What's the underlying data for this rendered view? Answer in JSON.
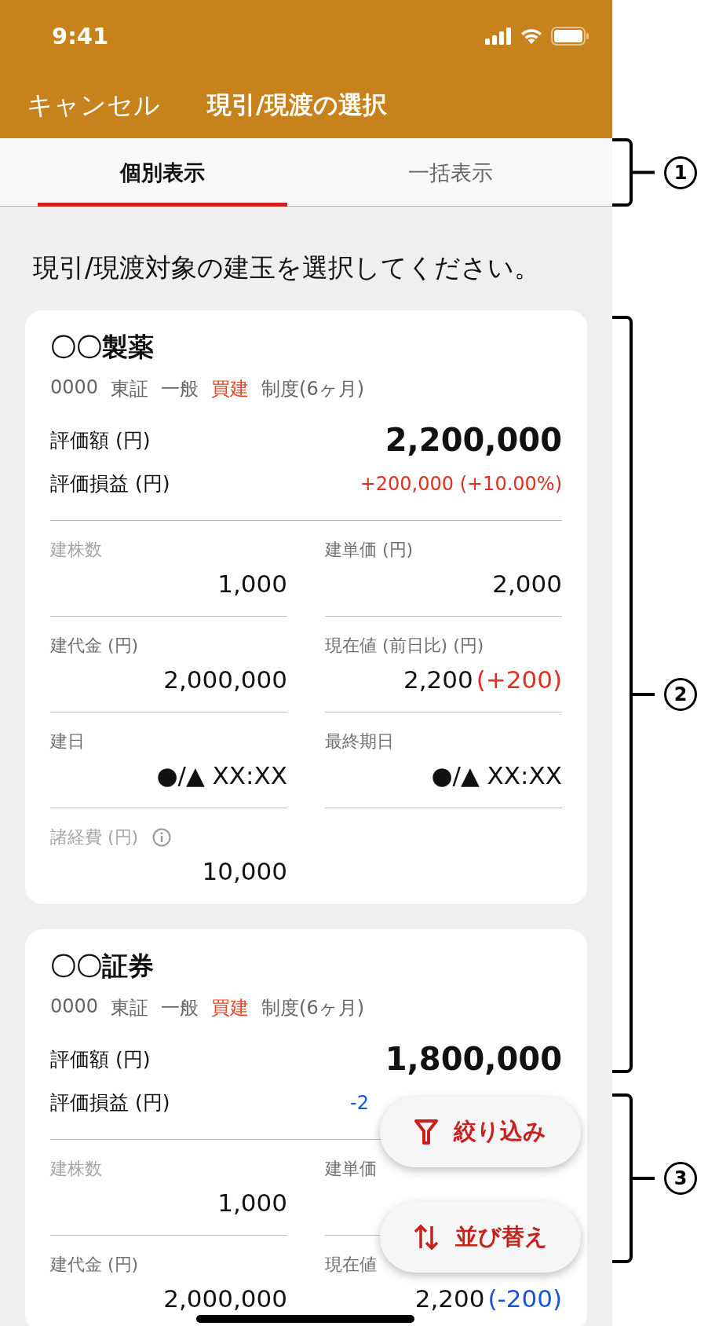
{
  "status_bar": {
    "time": "9:41"
  },
  "nav": {
    "cancel": "キャンセル",
    "title": "現引/現渡の選択"
  },
  "tabs": [
    {
      "label": "個別表示",
      "selected": true
    },
    {
      "label": "一括表示",
      "selected": false
    }
  ],
  "instruction": "現引/現渡対象の建玉を選択してください。",
  "cards": [
    {
      "name": "〇〇製薬",
      "meta": [
        {
          "text": "0000",
          "kind": "plain"
        },
        {
          "text": "東証",
          "kind": "plain"
        },
        {
          "text": "一般",
          "kind": "plain"
        },
        {
          "text": "買建",
          "kind": "side"
        },
        {
          "text": "制度(6ヶ月)",
          "kind": "plain"
        }
      ],
      "valuation_label": "評価額 (円)",
      "valuation": "2,200,000",
      "pl_label": "評価損益 (円)",
      "pl": {
        "text": "+200,000 (+10.00%)",
        "color": "#e0311f"
      },
      "fields": [
        {
          "label": "建株数",
          "value": "1,000",
          "muted": true
        },
        {
          "label": "建単価 (円)",
          "value": "2,000",
          "muted": false
        },
        {
          "label": "建代金 (円)",
          "value": "2,000,000",
          "muted": false
        },
        {
          "label": "現在値 (前日比) (円)",
          "value": "2,200",
          "change": "(+200)",
          "color": "#e0311f",
          "muted": false
        },
        {
          "label": "建日",
          "value": "●/▲ XX:XX",
          "muted": false
        },
        {
          "label": "最終期日",
          "value": "●/▲ XX:XX",
          "muted": false
        },
        {
          "label": "諸経費 (円)",
          "value": "10,000",
          "muted": true,
          "info": true
        }
      ]
    },
    {
      "name": "〇〇証券",
      "meta": [
        {
          "text": "0000",
          "kind": "plain"
        },
        {
          "text": "東証",
          "kind": "plain"
        },
        {
          "text": "一般",
          "kind": "plain"
        },
        {
          "text": "買建",
          "kind": "side"
        },
        {
          "text": "制度(6ヶ月)",
          "kind": "plain"
        }
      ],
      "valuation_label": "評価額 (円)",
      "valuation": "1,800,000",
      "pl_label": "評価損益 (円)",
      "pl": {
        "text": "-2",
        "color": "#1456d8"
      },
      "fields": [
        {
          "label": "建株数",
          "value": "1,000",
          "muted": true
        },
        {
          "label": "建単価",
          "muted": false
        },
        {
          "label": "建代金 (円)",
          "value": "2,000,000",
          "muted": false
        },
        {
          "label": "現在値",
          "value": "2,200",
          "change": "(-200)",
          "color": "#1456d8",
          "muted": false
        }
      ]
    }
  ],
  "fabs": [
    {
      "label": "絞り込み",
      "kind": "filter"
    },
    {
      "label": "並び替え",
      "kind": "sort"
    }
  ],
  "annotations": [
    {
      "label": "1"
    },
    {
      "label": "2"
    },
    {
      "label": "3"
    }
  ]
}
